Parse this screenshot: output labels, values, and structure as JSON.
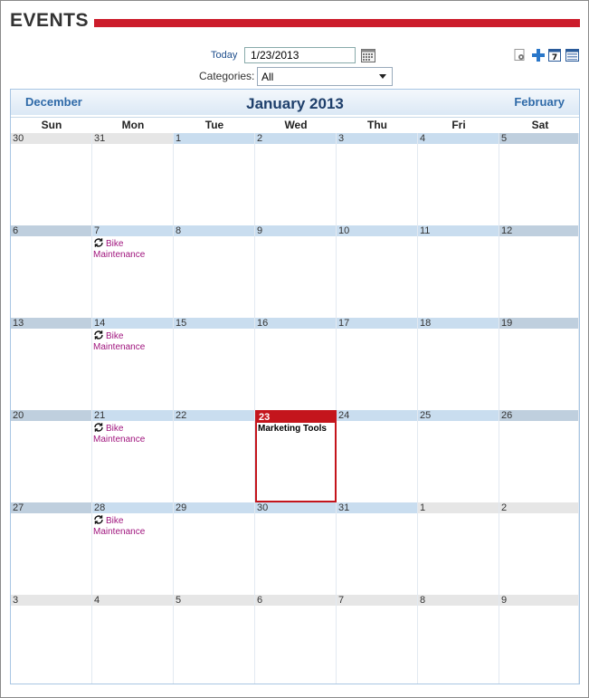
{
  "header": {
    "title": "EVENTS"
  },
  "filters": {
    "today_label": "Today",
    "date_value": "1/23/2013",
    "categories_label": "Categories:",
    "categories_value": "All"
  },
  "toolbar": {
    "icons": [
      "settings-icon",
      "add-icon",
      "week-view-icon",
      "list-view-icon"
    ]
  },
  "calendar": {
    "month_title": "January 2013",
    "prev_label": "December",
    "next_label": "February",
    "days_of_week": [
      "Sun",
      "Mon",
      "Tue",
      "Wed",
      "Thu",
      "Fri",
      "Sat"
    ],
    "weeks": [
      [
        {
          "day": "30",
          "in_month": false
        },
        {
          "day": "31",
          "in_month": false
        },
        {
          "day": "1",
          "in_month": true
        },
        {
          "day": "2",
          "in_month": true
        },
        {
          "day": "3",
          "in_month": true
        },
        {
          "day": "4",
          "in_month": true
        },
        {
          "day": "5",
          "in_month": true
        }
      ],
      [
        {
          "day": "6",
          "in_month": true
        },
        {
          "day": "7",
          "in_month": true,
          "events": [
            {
              "title": "Bike Maintenance",
              "recurring": true
            }
          ]
        },
        {
          "day": "8",
          "in_month": true
        },
        {
          "day": "9",
          "in_month": true
        },
        {
          "day": "10",
          "in_month": true
        },
        {
          "day": "11",
          "in_month": true
        },
        {
          "day": "12",
          "in_month": true
        }
      ],
      [
        {
          "day": "13",
          "in_month": true
        },
        {
          "day": "14",
          "in_month": true,
          "events": [
            {
              "title": "Bike Maintenance",
              "recurring": true
            }
          ]
        },
        {
          "day": "15",
          "in_month": true
        },
        {
          "day": "16",
          "in_month": true
        },
        {
          "day": "17",
          "in_month": true
        },
        {
          "day": "18",
          "in_month": true
        },
        {
          "day": "19",
          "in_month": true
        }
      ],
      [
        {
          "day": "20",
          "in_month": true
        },
        {
          "day": "21",
          "in_month": true,
          "events": [
            {
              "title": "Bike Maintenance",
              "recurring": true
            }
          ]
        },
        {
          "day": "22",
          "in_month": true
        },
        {
          "day": "23",
          "in_month": true,
          "today": true,
          "events": [
            {
              "title": "Marketing Tools",
              "recurring": false
            }
          ]
        },
        {
          "day": "24",
          "in_month": true
        },
        {
          "day": "25",
          "in_month": true
        },
        {
          "day": "26",
          "in_month": true
        }
      ],
      [
        {
          "day": "27",
          "in_month": true
        },
        {
          "day": "28",
          "in_month": true,
          "events": [
            {
              "title": "Bike Maintenance",
              "recurring": true
            }
          ]
        },
        {
          "day": "29",
          "in_month": true
        },
        {
          "day": "30",
          "in_month": true
        },
        {
          "day": "31",
          "in_month": true
        },
        {
          "day": "1",
          "in_month": false
        },
        {
          "day": "2",
          "in_month": false
        }
      ],
      [
        {
          "day": "3",
          "in_month": false
        },
        {
          "day": "4",
          "in_month": false
        },
        {
          "day": "5",
          "in_month": false
        },
        {
          "day": "6",
          "in_month": false
        },
        {
          "day": "7",
          "in_month": false
        },
        {
          "day": "8",
          "in_month": false
        },
        {
          "day": "9",
          "in_month": false
        }
      ]
    ]
  },
  "colors": {
    "accent": "#cc1c2b",
    "recurring_event": "#a0157e",
    "nav_link": "#2f6aa8"
  }
}
